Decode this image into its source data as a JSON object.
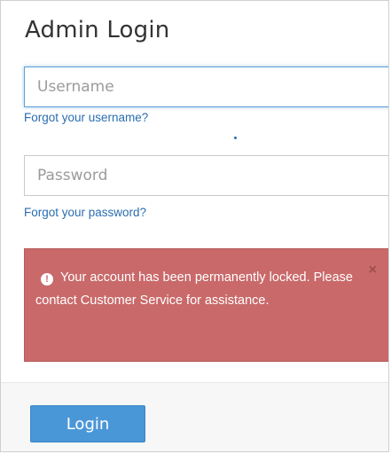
{
  "form": {
    "title": "Admin Login",
    "username": {
      "placeholder": "Username",
      "value": "",
      "focused": true
    },
    "forgot_username_link": "Forgot your username?",
    "password": {
      "placeholder": "Password",
      "value": ""
    },
    "forgot_password_link": "Forgot your password?",
    "login_button": "Login"
  },
  "alert": {
    "icon": "exclamation-circle-icon",
    "message": "Your account has been permanently locked. Please contact Customer Service for assistance.",
    "close_symbol": "×",
    "color": "#c9696a"
  },
  "colors": {
    "link": "#2a6db0",
    "button": "#4a97d8",
    "focus_border": "#5d9fd6"
  }
}
